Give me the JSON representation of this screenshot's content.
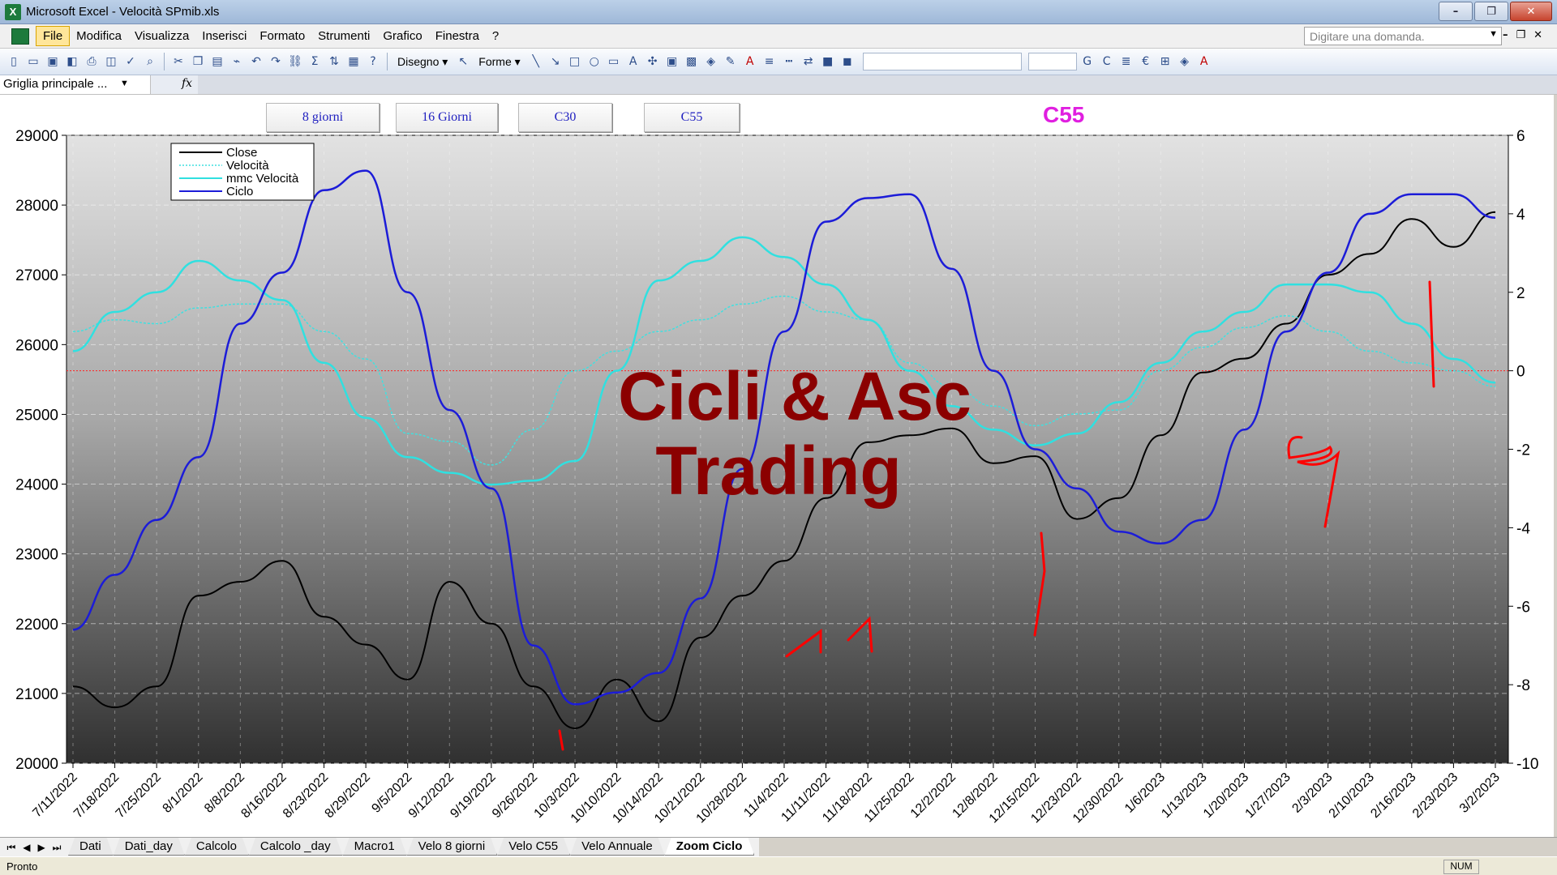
{
  "window": {
    "title": "Microsoft Excel - Velocità SPmib.xls",
    "controls": [
      "–",
      "❐",
      "✕"
    ]
  },
  "menubar": {
    "items": [
      "File",
      "Modifica",
      "Visualizza",
      "Inserisci",
      "Formato",
      "Strumenti",
      "Grafico",
      "Finestra",
      "?"
    ],
    "help_placeholder": "Digitare una domanda."
  },
  "toolbar": {
    "drawing_label": "Disegno ▾",
    "shapes_label": "Forme ▾"
  },
  "formula_bar": {
    "name_box": "Griglia principale ...",
    "fx": "fx"
  },
  "buttons": [
    {
      "label": "8 giorni"
    },
    {
      "label": "16 Giorni"
    },
    {
      "label": "C30"
    },
    {
      "label": "C55"
    }
  ],
  "chart_title": "C55",
  "chart_data": {
    "type": "line",
    "title": "C55",
    "watermark_lines": [
      "Cicli & Asc",
      "Trading"
    ],
    "y_left_ticks": [
      20000,
      21000,
      22000,
      23000,
      24000,
      25000,
      26000,
      27000,
      28000,
      29000
    ],
    "y_left_range": [
      20000,
      29000
    ],
    "y_right_ticks": [
      -10,
      -8,
      -6,
      -4,
      -2,
      0,
      2,
      4,
      6
    ],
    "y_right_range": [
      -10,
      6
    ],
    "x_tick_labels": [
      "7/11/2022",
      "7/18/2022",
      "7/25/2022",
      "8/1/2022",
      "8/8/2022",
      "8/16/2022",
      "8/23/2022",
      "8/29/2022",
      "9/5/2022",
      "9/12/2022",
      "9/19/2022",
      "9/26/2022",
      "10/3/2022",
      "10/10/2022",
      "10/14/2022",
      "10/21/2022",
      "10/28/2022",
      "11/4/2022",
      "11/11/2022",
      "11/18/2022",
      "11/25/2022",
      "12/2/2022",
      "12/8/2022",
      "12/15/2022",
      "12/23/2022",
      "12/30/2022",
      "1/6/2023",
      "1/13/2023",
      "1/20/2023",
      "1/27/2023",
      "2/3/2023",
      "2/10/2023",
      "2/16/2023",
      "2/23/2023",
      "3/2/2023"
    ],
    "legend": [
      "Close",
      "Velocità",
      "mmc Velocità",
      "Ciclo"
    ],
    "legend_position": "top-left",
    "grid": true,
    "colors": {
      "close": "#000000",
      "velocita": "#40e0e0",
      "mmc": "#30e0e0",
      "ciclo": "#1c1cd8",
      "zero_line": "#ff2020",
      "watermark": "#8b0000",
      "annotations": "#ff0000"
    },
    "series": [
      {
        "name": "Close",
        "axis": "left",
        "x": [
          0,
          1,
          2,
          3,
          4,
          5,
          6,
          7,
          8,
          9,
          10,
          11,
          12,
          13,
          14,
          15,
          16,
          17,
          18,
          19,
          20,
          21,
          22,
          23,
          24,
          25,
          26,
          27,
          28,
          29,
          30,
          31,
          32,
          33,
          34
        ],
        "values": [
          21100,
          20800,
          21100,
          22400,
          22600,
          22900,
          22100,
          21700,
          21200,
          22600,
          22000,
          21100,
          20500,
          21200,
          20600,
          21800,
          22400,
          22900,
          23800,
          24600,
          24700,
          24800,
          24300,
          24400,
          23500,
          23800,
          24700,
          25600,
          25800,
          26300,
          27000,
          27300,
          27800,
          27400,
          27900
        ]
      },
      {
        "name": "Velocità",
        "axis": "right",
        "x": [
          0,
          1,
          2,
          3,
          4,
          5,
          6,
          7,
          8,
          9,
          10,
          11,
          12,
          13,
          14,
          15,
          16,
          17,
          18,
          19,
          20,
          21,
          22,
          23,
          24,
          25,
          26,
          27,
          28,
          29,
          30,
          31,
          32,
          33,
          34
        ],
        "values": [
          1.0,
          1.3,
          1.2,
          1.6,
          1.7,
          1.7,
          1.0,
          0.3,
          -1.6,
          -1.8,
          -2.4,
          -1.5,
          0.0,
          0.5,
          1.0,
          1.3,
          1.7,
          1.9,
          1.5,
          1.3,
          0.2,
          -0.4,
          -0.9,
          -1.4,
          -1.1,
          -1.0,
          0.0,
          0.6,
          1.1,
          1.4,
          1.0,
          0.5,
          0.2,
          0.0,
          -0.4
        ]
      },
      {
        "name": "mmc Velocità",
        "axis": "right",
        "x": [
          0,
          1,
          2,
          3,
          4,
          5,
          6,
          7,
          8,
          9,
          10,
          11,
          12,
          13,
          14,
          15,
          16,
          17,
          18,
          19,
          20,
          21,
          22,
          23,
          24,
          25,
          26,
          27,
          28,
          29,
          30,
          31,
          32,
          33,
          34
        ],
        "values": [
          0.5,
          1.5,
          2.0,
          2.8,
          2.3,
          1.8,
          0.2,
          -1.2,
          -2.2,
          -2.6,
          -2.9,
          -2.8,
          -2.3,
          0.0,
          2.3,
          2.8,
          3.4,
          2.9,
          2.2,
          1.3,
          0.0,
          -0.9,
          -1.5,
          -1.9,
          -1.6,
          -0.8,
          0.2,
          1.0,
          1.5,
          2.2,
          2.2,
          2.0,
          1.2,
          0.3,
          -0.3
        ]
      },
      {
        "name": "Ciclo",
        "axis": "right",
        "x": [
          0,
          1,
          2,
          3,
          4,
          5,
          6,
          7,
          8,
          9,
          10,
          11,
          12,
          13,
          14,
          15,
          16,
          17,
          18,
          19,
          20,
          21,
          22,
          23,
          24,
          25,
          26,
          27,
          28,
          29,
          30,
          31,
          32,
          33,
          34
        ],
        "values": [
          -6.6,
          -5.2,
          -3.8,
          -2.2,
          1.2,
          2.5,
          4.6,
          5.1,
          2.0,
          -1.0,
          -3.0,
          -7.0,
          -8.5,
          -8.2,
          -7.7,
          -5.8,
          -2.5,
          1.0,
          3.8,
          4.4,
          4.5,
          2.6,
          0.0,
          -2.0,
          -3.0,
          -4.1,
          -4.4,
          -3.8,
          -1.5,
          1.0,
          2.5,
          4.0,
          4.5,
          4.5,
          3.9
        ]
      }
    ]
  },
  "sheet_tabs": [
    "Dati",
    "Dati_day",
    "Calcolo",
    "Calcolo _day",
    "Macro1",
    "Velo 8 giorni",
    "Velo C55",
    "Velo Annuale",
    "Zoom Ciclo"
  ],
  "active_tab": "Zoom Ciclo",
  "status": {
    "left": "Pronto",
    "num": "NUM"
  }
}
